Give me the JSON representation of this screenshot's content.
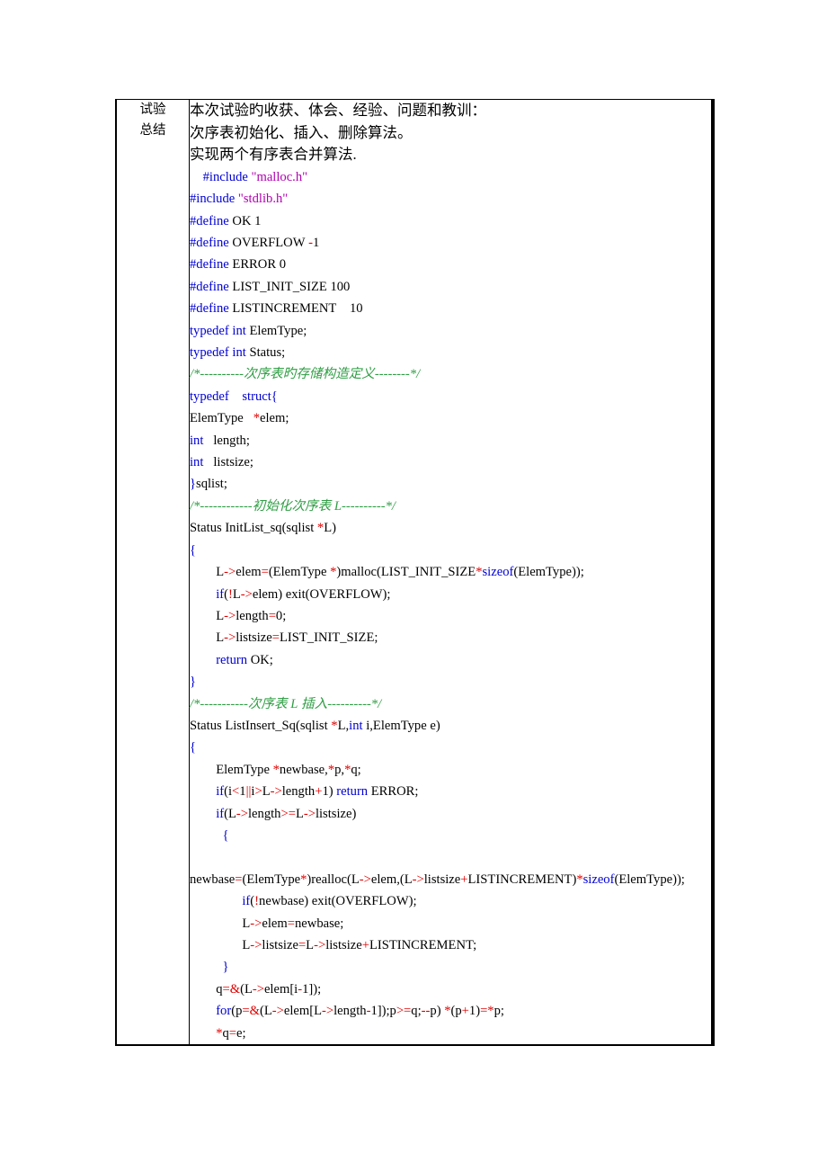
{
  "document": {
    "table": {
      "row_label": {
        "lines": [
          "试验",
          "总结"
        ]
      }
    },
    "headings": [
      "本次试验旳收获、体会、经验、问题和教训：",
      "次序表初始化、插入、删除算法。",
      "实现两个有序表合并算法."
    ],
    "code_lines": [
      {
        "indent": 2,
        "tokens": [
          {
            "text": "#include",
            "cls": "t-kw"
          },
          {
            "text": " ",
            "cls": "t-pl"
          },
          {
            "text": "\"malloc.h\"",
            "cls": "t-str"
          }
        ]
      },
      {
        "indent": 0,
        "tokens": [
          {
            "text": "#include",
            "cls": "t-kw"
          },
          {
            "text": " ",
            "cls": "t-pl"
          },
          {
            "text": "\"stdlib.h\"",
            "cls": "t-str"
          }
        ]
      },
      {
        "indent": 0,
        "tokens": [
          {
            "text": "#define",
            "cls": "t-kw"
          },
          {
            "text": " OK 1",
            "cls": "t-pl"
          }
        ]
      },
      {
        "indent": 0,
        "tokens": [
          {
            "text": "#define",
            "cls": "t-kw"
          },
          {
            "text": " OVERFLOW ",
            "cls": "t-pl"
          },
          {
            "text": "-",
            "cls": "t-op"
          },
          {
            "text": "1",
            "cls": "t-pl"
          }
        ]
      },
      {
        "indent": 0,
        "tokens": [
          {
            "text": "#define",
            "cls": "t-kw"
          },
          {
            "text": " ERROR 0",
            "cls": "t-pl"
          }
        ]
      },
      {
        "indent": 0,
        "tokens": [
          {
            "text": "#define",
            "cls": "t-kw"
          },
          {
            "text": " LIST_INIT_SIZE 100",
            "cls": "t-pl"
          }
        ]
      },
      {
        "indent": 0,
        "tokens": [
          {
            "text": "#define",
            "cls": "t-kw"
          },
          {
            "text": " LISTINCREMENT    10",
            "cls": "t-pl"
          }
        ]
      },
      {
        "indent": 0,
        "tokens": [
          {
            "text": "typedef",
            "cls": "t-kw"
          },
          {
            "text": " ",
            "cls": "t-pl"
          },
          {
            "text": "int",
            "cls": "t-kw"
          },
          {
            "text": " ElemType;",
            "cls": "t-pl"
          }
        ]
      },
      {
        "indent": 0,
        "tokens": [
          {
            "text": "typedef",
            "cls": "t-kw"
          },
          {
            "text": " ",
            "cls": "t-pl"
          },
          {
            "text": "int",
            "cls": "t-kw"
          },
          {
            "text": " Status;",
            "cls": "t-pl"
          }
        ]
      },
      {
        "indent": 0,
        "comment": true,
        "tokens": [
          {
            "text": "/*----------次序表旳存储构造定义--------*/",
            "cls": "t-cmt"
          }
        ]
      },
      {
        "indent": 0,
        "tokens": [
          {
            "text": "typedef",
            "cls": "t-kw"
          },
          {
            "text": "    ",
            "cls": "t-pl"
          },
          {
            "text": "struct",
            "cls": "t-kw"
          },
          {
            "text": "{",
            "cls": "t-kw"
          }
        ]
      },
      {
        "indent": 0,
        "tokens": [
          {
            "text": "ElemType   ",
            "cls": "t-pl"
          },
          {
            "text": "*",
            "cls": "t-op"
          },
          {
            "text": "elem;",
            "cls": "t-pl"
          }
        ]
      },
      {
        "indent": 0,
        "tokens": [
          {
            "text": "int",
            "cls": "t-kw"
          },
          {
            "text": "   length;",
            "cls": "t-pl"
          }
        ]
      },
      {
        "indent": 0,
        "tokens": [
          {
            "text": "int",
            "cls": "t-kw"
          },
          {
            "text": "   listsize;",
            "cls": "t-pl"
          }
        ]
      },
      {
        "indent": 0,
        "tokens": [
          {
            "text": "}",
            "cls": "t-kw"
          },
          {
            "text": "sqlist;",
            "cls": "t-pl"
          }
        ]
      },
      {
        "indent": 0,
        "comment": true,
        "tokens": [
          {
            "text": "/*------------初始化次序表 L----------*/",
            "cls": "t-cmt"
          }
        ]
      },
      {
        "indent": 0,
        "tokens": [
          {
            "text": "Status InitList_sq(sqlist ",
            "cls": "t-pl"
          },
          {
            "text": "*",
            "cls": "t-op"
          },
          {
            "text": "L)",
            "cls": "t-pl"
          }
        ]
      },
      {
        "indent": 0,
        "tokens": [
          {
            "text": "{",
            "cls": "t-kw"
          }
        ]
      },
      {
        "indent": 4,
        "tokens": [
          {
            "text": "L",
            "cls": "t-pl"
          },
          {
            "text": "-&gt;",
            "cls": "t-op"
          },
          {
            "text": "elem",
            "cls": "t-pl"
          },
          {
            "text": "=",
            "cls": "t-op"
          },
          {
            "text": "(ElemType ",
            "cls": "t-pl"
          },
          {
            "text": "*",
            "cls": "t-op"
          },
          {
            "text": ")malloc(LIST_INIT_SIZE",
            "cls": "t-pl"
          },
          {
            "text": "*",
            "cls": "t-op"
          },
          {
            "text": "sizeof",
            "cls": "t-kw"
          },
          {
            "text": "(ElemType));",
            "cls": "t-pl"
          }
        ]
      },
      {
        "indent": 4,
        "tokens": [
          {
            "text": "if",
            "cls": "t-kw"
          },
          {
            "text": "(",
            "cls": "t-pl"
          },
          {
            "text": "!",
            "cls": "t-op"
          },
          {
            "text": "L",
            "cls": "t-pl"
          },
          {
            "text": "-&gt;",
            "cls": "t-op"
          },
          {
            "text": "elem) exit(OVERFLOW);",
            "cls": "t-pl"
          }
        ]
      },
      {
        "indent": 4,
        "tokens": [
          {
            "text": "L",
            "cls": "t-pl"
          },
          {
            "text": "-&gt;",
            "cls": "t-op"
          },
          {
            "text": "length",
            "cls": "t-pl"
          },
          {
            "text": "=",
            "cls": "t-op"
          },
          {
            "text": "0;",
            "cls": "t-pl"
          }
        ]
      },
      {
        "indent": 4,
        "tokens": [
          {
            "text": "L",
            "cls": "t-pl"
          },
          {
            "text": "-&gt;",
            "cls": "t-op"
          },
          {
            "text": "listsize",
            "cls": "t-pl"
          },
          {
            "text": "=",
            "cls": "t-op"
          },
          {
            "text": "LIST_INIT_SIZE;",
            "cls": "t-pl"
          }
        ]
      },
      {
        "indent": 4,
        "tokens": [
          {
            "text": "return",
            "cls": "t-kw"
          },
          {
            "text": " OK;",
            "cls": "t-pl"
          }
        ]
      },
      {
        "indent": 0,
        "tokens": [
          {
            "text": "}",
            "cls": "t-kw"
          }
        ]
      },
      {
        "indent": 0,
        "comment": true,
        "tokens": [
          {
            "text": "/*-----------次序表 L 插入----------*/",
            "cls": "t-cmt"
          }
        ]
      },
      {
        "indent": 0,
        "tokens": [
          {
            "text": "Status ListInsert_Sq(sqlist ",
            "cls": "t-pl"
          },
          {
            "text": "*",
            "cls": "t-op"
          },
          {
            "text": "L,",
            "cls": "t-pl"
          },
          {
            "text": "int",
            "cls": "t-kw"
          },
          {
            "text": " i,ElemType e)",
            "cls": "t-pl"
          }
        ]
      },
      {
        "indent": 0,
        "tokens": [
          {
            "text": "{",
            "cls": "t-kw"
          }
        ]
      },
      {
        "indent": 4,
        "tokens": [
          {
            "text": "ElemType ",
            "cls": "t-pl"
          },
          {
            "text": "*",
            "cls": "t-op"
          },
          {
            "text": "newbase,",
            "cls": "t-pl"
          },
          {
            "text": "*",
            "cls": "t-op"
          },
          {
            "text": "p,",
            "cls": "t-pl"
          },
          {
            "text": "*",
            "cls": "t-op"
          },
          {
            "text": "q;",
            "cls": "t-pl"
          }
        ]
      },
      {
        "indent": 4,
        "tokens": [
          {
            "text": "if",
            "cls": "t-kw"
          },
          {
            "text": "(i",
            "cls": "t-pl"
          },
          {
            "text": "&lt;",
            "cls": "t-op"
          },
          {
            "text": "1",
            "cls": "t-pl"
          },
          {
            "text": "||",
            "cls": "t-op"
          },
          {
            "text": "i",
            "cls": "t-pl"
          },
          {
            "text": "&gt;",
            "cls": "t-op"
          },
          {
            "text": "L",
            "cls": "t-pl"
          },
          {
            "text": "-&gt;",
            "cls": "t-op"
          },
          {
            "text": "length",
            "cls": "t-pl"
          },
          {
            "text": "+",
            "cls": "t-op"
          },
          {
            "text": "1) ",
            "cls": "t-pl"
          },
          {
            "text": "return",
            "cls": "t-kw"
          },
          {
            "text": " ERROR;",
            "cls": "t-pl"
          }
        ]
      },
      {
        "indent": 4,
        "tokens": [
          {
            "text": "if",
            "cls": "t-kw"
          },
          {
            "text": "(L",
            "cls": "t-pl"
          },
          {
            "text": "-&gt;",
            "cls": "t-op"
          },
          {
            "text": "length",
            "cls": "t-pl"
          },
          {
            "text": "&gt;=",
            "cls": "t-op"
          },
          {
            "text": "L",
            "cls": "t-pl"
          },
          {
            "text": "-&gt;",
            "cls": "t-op"
          },
          {
            "text": "listsize)",
            "cls": "t-pl"
          }
        ]
      },
      {
        "indent": 5,
        "tokens": [
          {
            "text": "{",
            "cls": "t-kw"
          }
        ]
      },
      {
        "indent": 0,
        "blank": true,
        "tokens": []
      },
      {
        "indent": 0,
        "tokens": [
          {
            "text": "newbase",
            "cls": "t-pl"
          },
          {
            "text": "=",
            "cls": "t-op"
          },
          {
            "text": "(ElemType",
            "cls": "t-pl"
          },
          {
            "text": "*",
            "cls": "t-op"
          },
          {
            "text": ")realloc(L",
            "cls": "t-pl"
          },
          {
            "text": "-&gt;",
            "cls": "t-op"
          },
          {
            "text": "elem,(L",
            "cls": "t-pl"
          },
          {
            "text": "-&gt;",
            "cls": "t-op"
          },
          {
            "text": "listsize",
            "cls": "t-pl"
          },
          {
            "text": "+",
            "cls": "t-op"
          },
          {
            "text": "LISTINCREMENT)",
            "cls": "t-pl"
          },
          {
            "text": "*",
            "cls": "t-op"
          },
          {
            "text": "sizeof",
            "cls": "t-kw"
          },
          {
            "text": "(ElemType));",
            "cls": "t-pl"
          }
        ]
      },
      {
        "indent": 8,
        "tokens": [
          {
            "text": "if",
            "cls": "t-kw"
          },
          {
            "text": "(",
            "cls": "t-pl"
          },
          {
            "text": "!",
            "cls": "t-op"
          },
          {
            "text": "newbase) exit(OVERFLOW);",
            "cls": "t-pl"
          }
        ]
      },
      {
        "indent": 8,
        "tokens": [
          {
            "text": "L",
            "cls": "t-pl"
          },
          {
            "text": "-&gt;",
            "cls": "t-op"
          },
          {
            "text": "elem",
            "cls": "t-pl"
          },
          {
            "text": "=",
            "cls": "t-op"
          },
          {
            "text": "newbase;",
            "cls": "t-pl"
          }
        ]
      },
      {
        "indent": 8,
        "tokens": [
          {
            "text": "L",
            "cls": "t-pl"
          },
          {
            "text": "-&gt;",
            "cls": "t-op"
          },
          {
            "text": "listsize",
            "cls": "t-pl"
          },
          {
            "text": "=",
            "cls": "t-op"
          },
          {
            "text": "L",
            "cls": "t-pl"
          },
          {
            "text": "-&gt;",
            "cls": "t-op"
          },
          {
            "text": "listsize",
            "cls": "t-pl"
          },
          {
            "text": "+",
            "cls": "t-op"
          },
          {
            "text": "LISTINCREMENT;",
            "cls": "t-pl"
          }
        ]
      },
      {
        "indent": 5,
        "tokens": [
          {
            "text": "}",
            "cls": "t-kw"
          }
        ]
      },
      {
        "indent": 4,
        "tokens": [
          {
            "text": "q",
            "cls": "t-pl"
          },
          {
            "text": "=&amp;",
            "cls": "t-op"
          },
          {
            "text": "(L",
            "cls": "t-pl"
          },
          {
            "text": "-&gt;",
            "cls": "t-op"
          },
          {
            "text": "elem[i",
            "cls": "t-pl"
          },
          {
            "text": "-",
            "cls": "t-op"
          },
          {
            "text": "1]);",
            "cls": "t-pl"
          }
        ]
      },
      {
        "indent": 4,
        "tokens": [
          {
            "text": "for",
            "cls": "t-kw"
          },
          {
            "text": "(p",
            "cls": "t-pl"
          },
          {
            "text": "=&amp;",
            "cls": "t-op"
          },
          {
            "text": "(L",
            "cls": "t-pl"
          },
          {
            "text": "-&gt;",
            "cls": "t-op"
          },
          {
            "text": "elem[L",
            "cls": "t-pl"
          },
          {
            "text": "-&gt;",
            "cls": "t-op"
          },
          {
            "text": "length",
            "cls": "t-pl"
          },
          {
            "text": "-",
            "cls": "t-op"
          },
          {
            "text": "1]);p",
            "cls": "t-pl"
          },
          {
            "text": "&gt;=",
            "cls": "t-op"
          },
          {
            "text": "q;",
            "cls": "t-pl"
          },
          {
            "text": "--",
            "cls": "t-op"
          },
          {
            "text": "p) ",
            "cls": "t-pl"
          },
          {
            "text": "*",
            "cls": "t-op"
          },
          {
            "text": "(p",
            "cls": "t-pl"
          },
          {
            "text": "+",
            "cls": "t-op"
          },
          {
            "text": "1)",
            "cls": "t-pl"
          },
          {
            "text": "=*",
            "cls": "t-op"
          },
          {
            "text": "p;",
            "cls": "t-pl"
          }
        ]
      },
      {
        "indent": 4,
        "tokens": [
          {
            "text": "*",
            "cls": "t-op"
          },
          {
            "text": "q",
            "cls": "t-pl"
          },
          {
            "text": "=",
            "cls": "t-op"
          },
          {
            "text": "e;",
            "cls": "t-pl"
          }
        ]
      }
    ],
    "colors": {
      "keyword": "#0000d4",
      "string": "#b000b0",
      "operator": "#e00000",
      "comment": "#2f9e44",
      "plain": "#000000",
      "border": "#000000",
      "background": "#ffffff"
    }
  }
}
